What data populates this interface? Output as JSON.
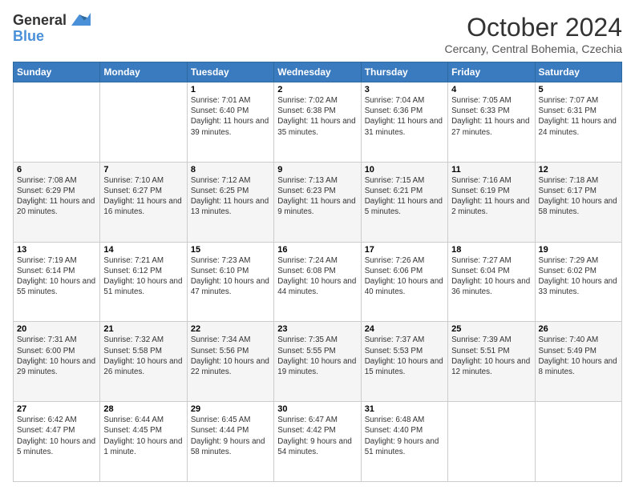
{
  "logo": {
    "line1": "General",
    "line2": "Blue"
  },
  "title": "October 2024",
  "location": "Cercany, Central Bohemia, Czechia",
  "days_of_week": [
    "Sunday",
    "Monday",
    "Tuesday",
    "Wednesday",
    "Thursday",
    "Friday",
    "Saturday"
  ],
  "weeks": [
    [
      {
        "day": "",
        "info": ""
      },
      {
        "day": "",
        "info": ""
      },
      {
        "day": "1",
        "info": "Sunrise: 7:01 AM\nSunset: 6:40 PM\nDaylight: 11 hours and 39 minutes."
      },
      {
        "day": "2",
        "info": "Sunrise: 7:02 AM\nSunset: 6:38 PM\nDaylight: 11 hours and 35 minutes."
      },
      {
        "day": "3",
        "info": "Sunrise: 7:04 AM\nSunset: 6:36 PM\nDaylight: 11 hours and 31 minutes."
      },
      {
        "day": "4",
        "info": "Sunrise: 7:05 AM\nSunset: 6:33 PM\nDaylight: 11 hours and 27 minutes."
      },
      {
        "day": "5",
        "info": "Sunrise: 7:07 AM\nSunset: 6:31 PM\nDaylight: 11 hours and 24 minutes."
      }
    ],
    [
      {
        "day": "6",
        "info": "Sunrise: 7:08 AM\nSunset: 6:29 PM\nDaylight: 11 hours and 20 minutes."
      },
      {
        "day": "7",
        "info": "Sunrise: 7:10 AM\nSunset: 6:27 PM\nDaylight: 11 hours and 16 minutes."
      },
      {
        "day": "8",
        "info": "Sunrise: 7:12 AM\nSunset: 6:25 PM\nDaylight: 11 hours and 13 minutes."
      },
      {
        "day": "9",
        "info": "Sunrise: 7:13 AM\nSunset: 6:23 PM\nDaylight: 11 hours and 9 minutes."
      },
      {
        "day": "10",
        "info": "Sunrise: 7:15 AM\nSunset: 6:21 PM\nDaylight: 11 hours and 5 minutes."
      },
      {
        "day": "11",
        "info": "Sunrise: 7:16 AM\nSunset: 6:19 PM\nDaylight: 11 hours and 2 minutes."
      },
      {
        "day": "12",
        "info": "Sunrise: 7:18 AM\nSunset: 6:17 PM\nDaylight: 10 hours and 58 minutes."
      }
    ],
    [
      {
        "day": "13",
        "info": "Sunrise: 7:19 AM\nSunset: 6:14 PM\nDaylight: 10 hours and 55 minutes."
      },
      {
        "day": "14",
        "info": "Sunrise: 7:21 AM\nSunset: 6:12 PM\nDaylight: 10 hours and 51 minutes."
      },
      {
        "day": "15",
        "info": "Sunrise: 7:23 AM\nSunset: 6:10 PM\nDaylight: 10 hours and 47 minutes."
      },
      {
        "day": "16",
        "info": "Sunrise: 7:24 AM\nSunset: 6:08 PM\nDaylight: 10 hours and 44 minutes."
      },
      {
        "day": "17",
        "info": "Sunrise: 7:26 AM\nSunset: 6:06 PM\nDaylight: 10 hours and 40 minutes."
      },
      {
        "day": "18",
        "info": "Sunrise: 7:27 AM\nSunset: 6:04 PM\nDaylight: 10 hours and 36 minutes."
      },
      {
        "day": "19",
        "info": "Sunrise: 7:29 AM\nSunset: 6:02 PM\nDaylight: 10 hours and 33 minutes."
      }
    ],
    [
      {
        "day": "20",
        "info": "Sunrise: 7:31 AM\nSunset: 6:00 PM\nDaylight: 10 hours and 29 minutes."
      },
      {
        "day": "21",
        "info": "Sunrise: 7:32 AM\nSunset: 5:58 PM\nDaylight: 10 hours and 26 minutes."
      },
      {
        "day": "22",
        "info": "Sunrise: 7:34 AM\nSunset: 5:56 PM\nDaylight: 10 hours and 22 minutes."
      },
      {
        "day": "23",
        "info": "Sunrise: 7:35 AM\nSunset: 5:55 PM\nDaylight: 10 hours and 19 minutes."
      },
      {
        "day": "24",
        "info": "Sunrise: 7:37 AM\nSunset: 5:53 PM\nDaylight: 10 hours and 15 minutes."
      },
      {
        "day": "25",
        "info": "Sunrise: 7:39 AM\nSunset: 5:51 PM\nDaylight: 10 hours and 12 minutes."
      },
      {
        "day": "26",
        "info": "Sunrise: 7:40 AM\nSunset: 5:49 PM\nDaylight: 10 hours and 8 minutes."
      }
    ],
    [
      {
        "day": "27",
        "info": "Sunrise: 6:42 AM\nSunset: 4:47 PM\nDaylight: 10 hours and 5 minutes."
      },
      {
        "day": "28",
        "info": "Sunrise: 6:44 AM\nSunset: 4:45 PM\nDaylight: 10 hours and 1 minute."
      },
      {
        "day": "29",
        "info": "Sunrise: 6:45 AM\nSunset: 4:44 PM\nDaylight: 9 hours and 58 minutes."
      },
      {
        "day": "30",
        "info": "Sunrise: 6:47 AM\nSunset: 4:42 PM\nDaylight: 9 hours and 54 minutes."
      },
      {
        "day": "31",
        "info": "Sunrise: 6:48 AM\nSunset: 4:40 PM\nDaylight: 9 hours and 51 minutes."
      },
      {
        "day": "",
        "info": ""
      },
      {
        "day": "",
        "info": ""
      }
    ]
  ]
}
